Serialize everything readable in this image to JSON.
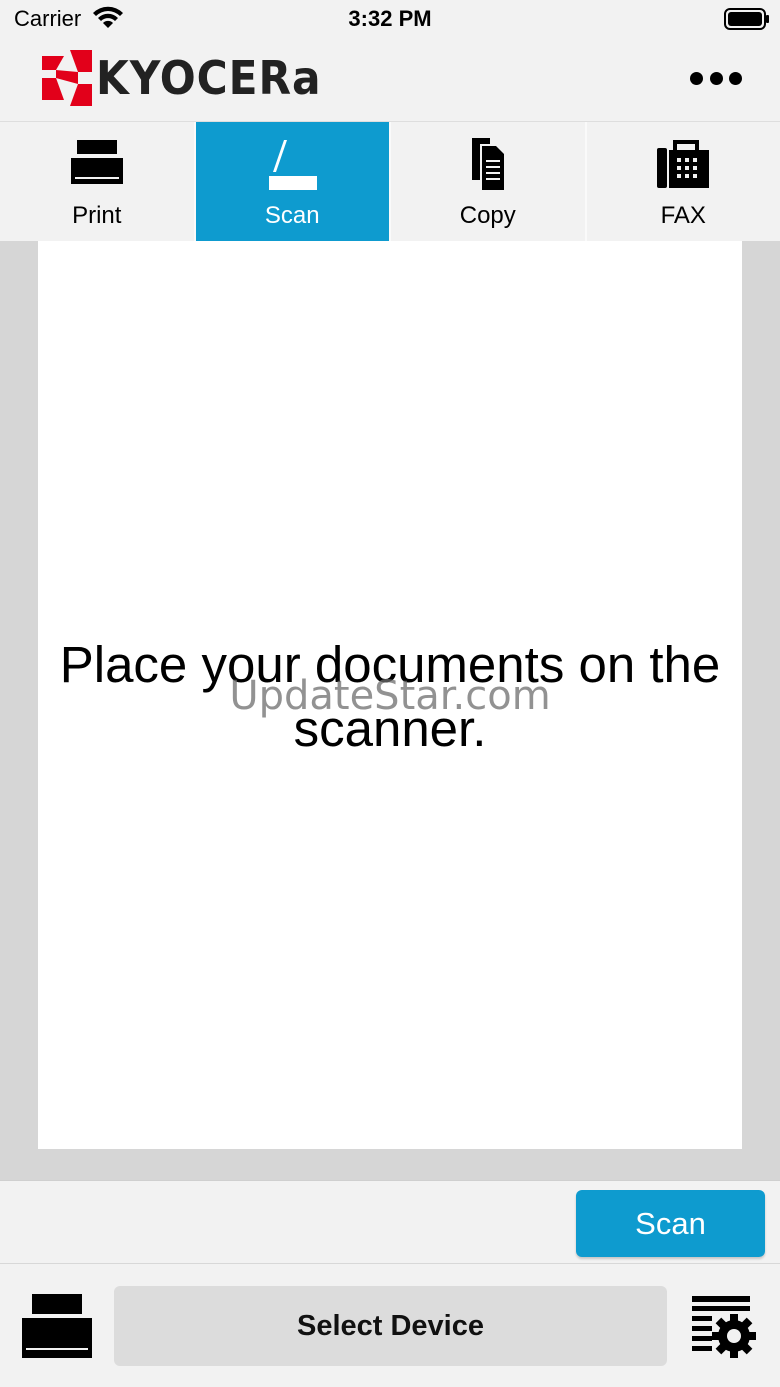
{
  "status_bar": {
    "carrier": "Carrier",
    "time": "3:32 PM"
  },
  "header": {
    "logo_text": "KYOCERa",
    "brand_color": "#e2001a",
    "more_icon": "more-horizontal-icon"
  },
  "tabs": [
    {
      "label": "Print",
      "icon": "printer-icon",
      "active": false
    },
    {
      "label": "Scan",
      "icon": "scanner-icon",
      "active": true
    },
    {
      "label": "Copy",
      "icon": "copy-icon",
      "active": false
    },
    {
      "label": "FAX",
      "icon": "fax-icon",
      "active": false
    }
  ],
  "accent_color": "#0e9bcf",
  "preview": {
    "message": "Place your documents on the scanner.",
    "watermark": "UpdateStar.com"
  },
  "actions": {
    "scan_label": "Scan"
  },
  "bottom": {
    "select_device_label": "Select Device",
    "device_icon": "printer-icon",
    "settings_icon": "document-settings-icon"
  }
}
